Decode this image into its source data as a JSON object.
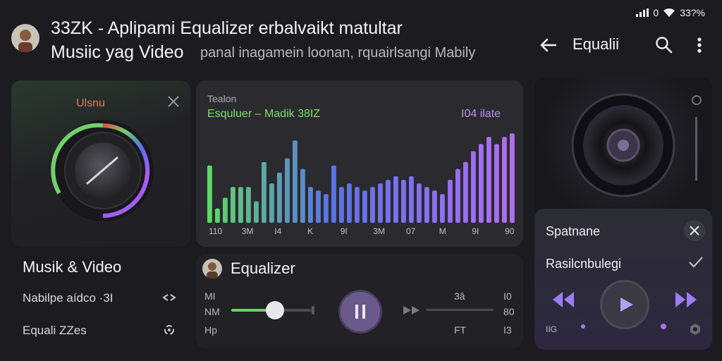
{
  "status": {
    "text": "33?%",
    "time": "0"
  },
  "header": {
    "title_line1": "33ZK - Aplipami Equalizer erbalvaikt matultar",
    "title_line2": "Musiic yag Video",
    "subtitle": "panal inagamein loonan, rquairlsangi Mabily"
  },
  "topbar": {
    "title": "Equalii"
  },
  "dial": {
    "label": "Ulsnu"
  },
  "equalizer": {
    "small_label": "Tealon",
    "title": "Esquluer – Madik 38IZ",
    "rate": "I04 ilate",
    "colors": {
      "start": "#5fd86a",
      "end": "#b06ef0"
    }
  },
  "chart_data": {
    "type": "bar",
    "categories": [
      "110",
      "3M",
      "I4",
      "K",
      "9I",
      "3M",
      "07",
      "M",
      "9I",
      "90"
    ],
    "values": [
      16,
      4,
      7,
      10,
      10,
      10,
      6,
      17,
      11,
      14,
      18,
      23,
      15,
      10,
      9,
      8,
      16,
      10,
      11,
      10,
      9,
      10,
      11,
      12,
      13,
      12,
      13,
      11,
      10,
      9,
      8,
      12,
      15,
      17,
      20,
      22,
      24,
      22,
      24,
      25
    ],
    "title": "Esquluer – Madik 38IZ"
  },
  "speaker_panel": {
    "title1": "Spatnane",
    "title2": "Rasilcnbulegi",
    "mini": "IIG"
  },
  "left_list": {
    "section_title": "Musik & Video",
    "row1": "Nabilpe aídco ·3I",
    "row2": "Equali ZZes"
  },
  "player": {
    "title": "Equalizer",
    "slider_percent": 55,
    "labels_left": [
      "MI",
      "NM",
      "Hp"
    ],
    "labels_mid": [
      "3â",
      "FT"
    ],
    "labels_right": [
      "I0",
      "80",
      "I3"
    ]
  }
}
